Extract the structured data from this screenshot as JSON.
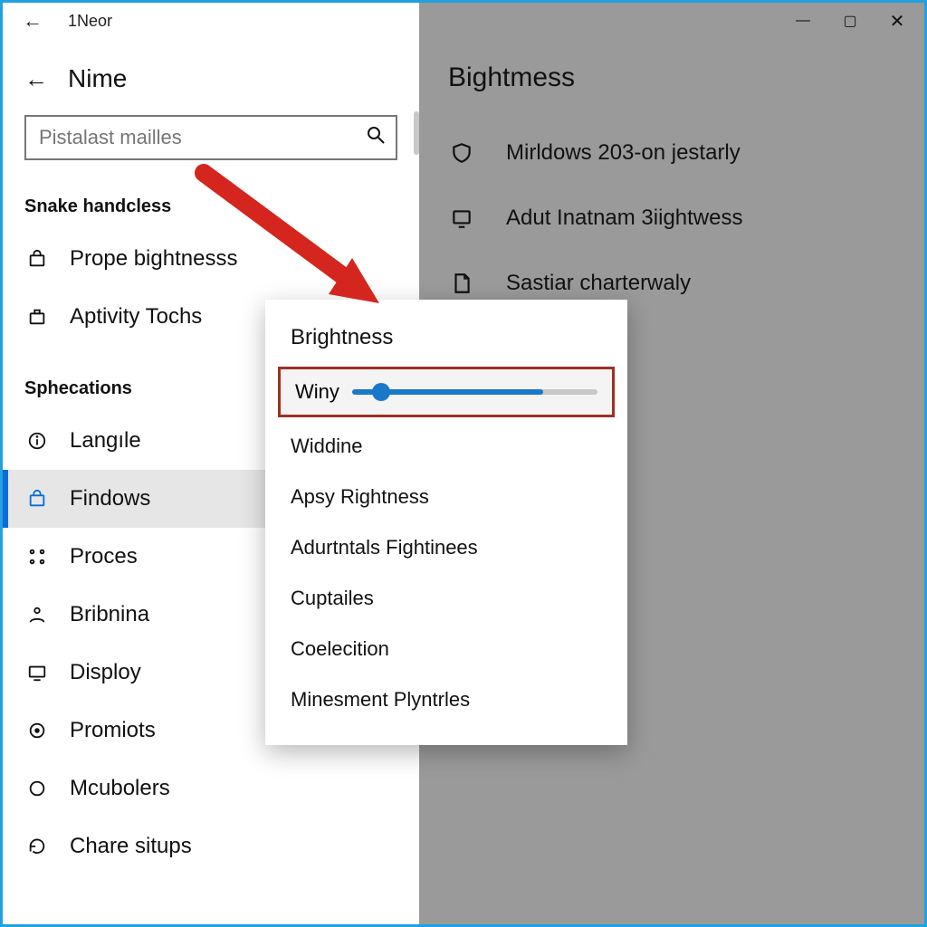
{
  "titlebar": {
    "app_hint": "1Neor",
    "minimize_glyph": "—",
    "maximize_glyph": "▢",
    "close_glyph": "✕",
    "back_glyph": "←"
  },
  "sidebar": {
    "back_glyph": "←",
    "header_label": "Nime",
    "search_placeholder": "Pistalast mailles",
    "sections": {
      "one_title": "Snake handcless",
      "two_title": "Sphecations"
    },
    "items_one": [
      {
        "icon": "bag-icon",
        "label": "Prope bightnesss"
      },
      {
        "icon": "puzzle-icon",
        "label": "Aptivity Tochs"
      }
    ],
    "items_two": [
      {
        "icon": "info-icon",
        "label": "Langıle"
      },
      {
        "icon": "bag-icon",
        "label": "Findows",
        "selected": true
      },
      {
        "icon": "nodes-icon",
        "label": "Proces"
      },
      {
        "icon": "person-icon",
        "label": "Bribnina"
      },
      {
        "icon": "display-icon",
        "label": "Disploy"
      },
      {
        "icon": "target-icon",
        "label": "Promiots"
      },
      {
        "icon": "circle-icon",
        "label": "Mcubolers"
      },
      {
        "icon": "refresh-icon",
        "label": "Chare situps"
      }
    ]
  },
  "main": {
    "title": "Bightmess",
    "rows": [
      {
        "icon": "shield-icon",
        "label": "Mirldows 203-on jestarly"
      },
      {
        "icon": "monitor-icon",
        "label": "Adut Inatnam 3iightwess"
      },
      {
        "icon": "file-icon",
        "label": "Sastiar charterwaly"
      }
    ]
  },
  "popup": {
    "title": "Brightness",
    "slider_label": "Winy",
    "slider_value_pct": 12,
    "slider_fill_pct": 78,
    "items": [
      "Widdine",
      "Apsy Rightness",
      "Adurtntals Fightinees",
      "Cuptailes",
      "Coelecition",
      "Minesment Plyntrles"
    ]
  },
  "colors": {
    "accent": "#0a6cd6",
    "slider": "#1978c8",
    "highlight_border": "#a03020",
    "arrow": "#d4261e",
    "window_border": "#22a0e0",
    "main_bg": "#9a9a9a"
  }
}
